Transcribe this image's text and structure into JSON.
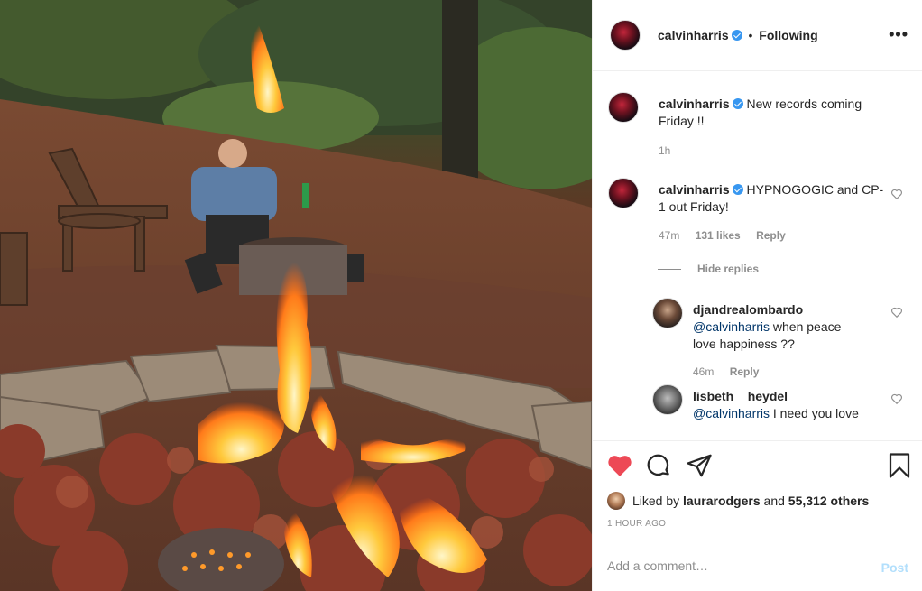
{
  "header": {
    "username": "calvinharris",
    "separator": "•",
    "follow_state": "Following",
    "more_label": "•••"
  },
  "caption": {
    "username": "calvinharris",
    "text": "New records coming Friday !!",
    "time": "1h"
  },
  "comments": [
    {
      "username": "calvinharris",
      "text": "HYPNOGOGIC and CP-1 out Friday!",
      "time": "47m",
      "likes": "131 likes",
      "reply": "Reply"
    }
  ],
  "hide_replies": "Hide replies",
  "replies": [
    {
      "username": "djandrealombardo",
      "mention": "@calvinharris",
      "text": "when peace love happiness ??",
      "time": "46m",
      "reply": "Reply"
    },
    {
      "username": "lisbeth__heydel",
      "mention": "@calvinharris",
      "text": "I need you love"
    }
  ],
  "likes": {
    "prefix": "Liked by",
    "user": "laurarodgers",
    "connector": "and",
    "others": "55,312 others"
  },
  "posted": "1 HOUR AGO",
  "comment_box": {
    "placeholder": "Add a comment…",
    "post_label": "Post"
  },
  "colors": {
    "heart": "#ed4956",
    "verified": "#3897f0",
    "post_disabled": "#b2dffc"
  },
  "icons": [
    "heart-icon",
    "comment-icon",
    "share-icon",
    "bookmark-icon",
    "verified-badge-icon",
    "more-options-icon"
  ]
}
